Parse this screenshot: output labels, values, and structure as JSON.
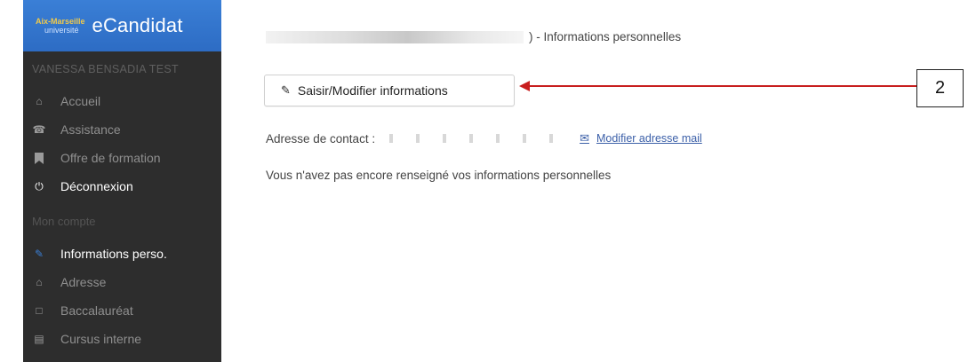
{
  "sidebar": {
    "logo_line1": "Aix-Marseille",
    "logo_line2": "université",
    "app_name": "eCandidat",
    "user_name": "VANESSA BENSADIA TEST",
    "menu": [
      {
        "label": "Accueil",
        "icon": "home-icon"
      },
      {
        "label": "Assistance",
        "icon": "support-icon"
      },
      {
        "label": "Offre de formation",
        "icon": "bookmark-icon"
      },
      {
        "label": "Déconnexion",
        "icon": "power-icon"
      }
    ],
    "section_title": "Mon compte",
    "account_items": [
      {
        "label": "Informations perso.",
        "icon": "pencil-icon"
      },
      {
        "label": "Adresse",
        "icon": "home-icon"
      },
      {
        "label": "Baccalauréat",
        "icon": "graduation-icon"
      },
      {
        "label": "Cursus interne",
        "icon": "institution-icon"
      }
    ]
  },
  "main": {
    "title_suffix": ") - Informations personnelles",
    "edit_button_label": "Saisir/Modifier informations",
    "contact_label": "Adresse de contact :",
    "modify_mail_label": "Modifier adresse mail",
    "info_message": "Vous n'avez pas encore renseigné vos informations personnelles"
  },
  "annotation": {
    "number": "2",
    "arrow_color": "#c81e1e"
  }
}
